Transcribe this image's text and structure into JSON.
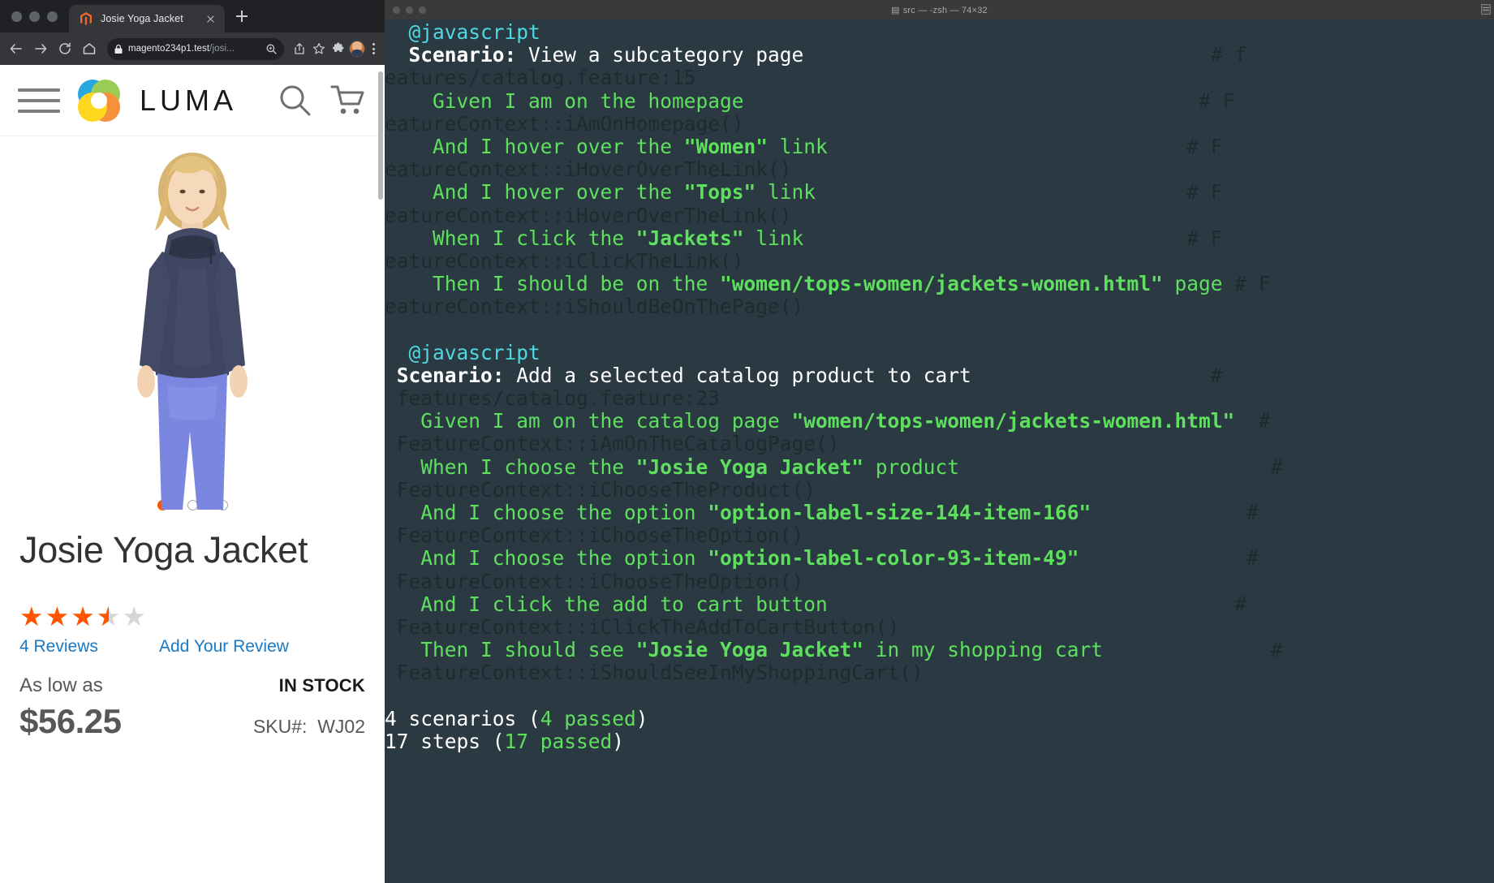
{
  "browser": {
    "tab": {
      "title": "Josie Yoga Jacket",
      "favicon": "magento-icon",
      "close_label": "×"
    },
    "new_tab_label": "+",
    "toolbar": {
      "back_icon": "back-arrow-icon",
      "forward_icon": "forward-arrow-icon",
      "reload_icon": "reload-icon",
      "home_icon": "home-icon",
      "lock_icon": "lock-icon",
      "url_host": "magento234p1.test",
      "url_path": "/josi...",
      "zoom_icon": "zoom-search-icon",
      "share_icon": "share-icon",
      "bookmark_icon": "star-icon",
      "extensions_icon": "puzzle-icon",
      "profile_icon": "avatar",
      "menu_icon": "kebab-menu-icon"
    }
  },
  "store": {
    "brand": "LUMA",
    "logo_name": "luma-logo",
    "menu_icon": "hamburger-icon",
    "search_icon": "search-icon",
    "cart_icon": "cart-icon",
    "gallery": {
      "dots": [
        {
          "active": true
        },
        {
          "active": false
        },
        {
          "active": false
        }
      ]
    },
    "product": {
      "title": "Josie Yoga Jacket",
      "rating_stars": 3.5,
      "stars": [
        "full",
        "full",
        "full",
        "half",
        "empty"
      ],
      "reviews_link": "4  Reviews",
      "add_review_link": "Add Your Review",
      "as_low_as_label": "As low as",
      "price": "$56.25",
      "stock_status": "IN STOCK",
      "sku_label": "SKU#:",
      "sku_value": "WJ02"
    }
  },
  "terminal": {
    "title": "src — -zsh — 74×32",
    "title_icon": "terminal-icon",
    "lines": [
      {
        "id": "l01",
        "segments": [
          {
            "t": "  ",
            "c": "c-step"
          },
          {
            "t": "@javascript",
            "c": "c-tag"
          }
        ]
      },
      {
        "id": "l02",
        "segments": [
          {
            "t": "  ",
            "c": "c-white"
          },
          {
            "t": "Scenario:",
            "c": "c-wbold"
          },
          {
            "t": " View a subcategory page",
            "c": "c-white"
          },
          {
            "t": "                                  # f",
            "c": "c-dim"
          }
        ]
      },
      {
        "id": "l03",
        "segments": [
          {
            "t": "eatures/catalog.feature:15",
            "c": "c-dim"
          }
        ]
      },
      {
        "id": "l04",
        "segments": [
          {
            "t": "    Given I am on the homepage",
            "c": "c-step"
          },
          {
            "t": "                                      # F",
            "c": "c-dim"
          }
        ]
      },
      {
        "id": "l05",
        "segments": [
          {
            "t": "eatureContext::iAmOnHomepage()",
            "c": "c-dim"
          }
        ]
      },
      {
        "id": "l06",
        "segments": [
          {
            "t": "    And I hover over the ",
            "c": "c-step"
          },
          {
            "t": "\"Women\"",
            "c": "c-bold"
          },
          {
            "t": " link",
            "c": "c-step"
          },
          {
            "t": "                              # F",
            "c": "c-dim"
          }
        ]
      },
      {
        "id": "l07",
        "segments": [
          {
            "t": "eatureContext::iHoverOverTheLink()",
            "c": "c-dim"
          }
        ]
      },
      {
        "id": "l08",
        "segments": [
          {
            "t": "    And I hover over the ",
            "c": "c-step"
          },
          {
            "t": "\"Tops\"",
            "c": "c-bold"
          },
          {
            "t": " link",
            "c": "c-step"
          },
          {
            "t": "                               # F",
            "c": "c-dim"
          }
        ]
      },
      {
        "id": "l09",
        "segments": [
          {
            "t": "eatureContext::iHoverOverTheLink()",
            "c": "c-dim"
          }
        ]
      },
      {
        "id": "l10",
        "segments": [
          {
            "t": "    When I click the ",
            "c": "c-step"
          },
          {
            "t": "\"Jackets\"",
            "c": "c-bold"
          },
          {
            "t": " link",
            "c": "c-step"
          },
          {
            "t": "                                # F",
            "c": "c-dim"
          }
        ]
      },
      {
        "id": "l11",
        "segments": [
          {
            "t": "eatureContext::iClickTheLink()",
            "c": "c-dim"
          }
        ]
      },
      {
        "id": "l12",
        "segments": [
          {
            "t": "    Then I should be on the ",
            "c": "c-step"
          },
          {
            "t": "\"women/tops-women/jackets-women.html\"",
            "c": "c-bold"
          },
          {
            "t": " page",
            "c": "c-step"
          },
          {
            "t": " # F",
            "c": "c-dim"
          }
        ]
      },
      {
        "id": "l13",
        "segments": [
          {
            "t": "eatureContext::iShouldBeOnThePage()",
            "c": "c-dim"
          }
        ]
      },
      {
        "id": "l14",
        "segments": [
          {
            "t": "",
            "c": "c-step"
          }
        ]
      },
      {
        "id": "l15",
        "segments": [
          {
            "t": "  ",
            "c": "c-step"
          },
          {
            "t": "@javascript",
            "c": "c-tag"
          }
        ]
      },
      {
        "id": "l16",
        "segments": [
          {
            "t": " ",
            "c": "c-white"
          },
          {
            "t": "Scenario:",
            "c": "c-wbold"
          },
          {
            "t": " Add a selected catalog product to cart",
            "c": "c-white"
          },
          {
            "t": "                    #",
            "c": "c-dim"
          }
        ]
      },
      {
        "id": "l17",
        "segments": [
          {
            "t": " features/catalog.feature:23",
            "c": "c-dim"
          }
        ]
      },
      {
        "id": "l18",
        "segments": [
          {
            "t": "   Given I am on the catalog page ",
            "c": "c-step"
          },
          {
            "t": "\"women/tops-women/jackets-women.html\"",
            "c": "c-bold"
          },
          {
            "t": "  #",
            "c": "c-dim"
          }
        ]
      },
      {
        "id": "l19",
        "segments": [
          {
            "t": " FeatureContext::iAmOnTheCatalogPage()",
            "c": "c-dim"
          }
        ]
      },
      {
        "id": "l20",
        "segments": [
          {
            "t": "   When I choose the ",
            "c": "c-step"
          },
          {
            "t": "\"Josie Yoga Jacket\"",
            "c": "c-bold"
          },
          {
            "t": " product",
            "c": "c-step"
          },
          {
            "t": "                          #",
            "c": "c-dim"
          }
        ]
      },
      {
        "id": "l21",
        "segments": [
          {
            "t": " FeatureContext::iChooseTheProduct()",
            "c": "c-dim"
          }
        ]
      },
      {
        "id": "l22",
        "segments": [
          {
            "t": "   And I choose the option ",
            "c": "c-step"
          },
          {
            "t": "\"option-label-size-144-item-166\"",
            "c": "c-bold"
          },
          {
            "t": "             #",
            "c": "c-dim"
          }
        ]
      },
      {
        "id": "l23",
        "segments": [
          {
            "t": " FeatureContext::iChooseTheOption()",
            "c": "c-dim"
          }
        ]
      },
      {
        "id": "l24",
        "segments": [
          {
            "t": "   And I choose the option ",
            "c": "c-step"
          },
          {
            "t": "\"option-label-color-93-item-49\"",
            "c": "c-bold"
          },
          {
            "t": "              #",
            "c": "c-dim"
          }
        ]
      },
      {
        "id": "l25",
        "segments": [
          {
            "t": " FeatureContext::iChooseTheOption()",
            "c": "c-dim"
          }
        ]
      },
      {
        "id": "l26",
        "segments": [
          {
            "t": "   And I click the add to cart button",
            "c": "c-step"
          },
          {
            "t": "                                  #",
            "c": "c-dim"
          }
        ]
      },
      {
        "id": "l27",
        "segments": [
          {
            "t": " FeatureContext::iClickTheAddToCartButton()",
            "c": "c-dim"
          }
        ]
      },
      {
        "id": "l28",
        "segments": [
          {
            "t": "   Then I should see ",
            "c": "c-step"
          },
          {
            "t": "\"Josie Yoga Jacket\"",
            "c": "c-bold"
          },
          {
            "t": " in my shopping cart",
            "c": "c-step"
          },
          {
            "t": "              #",
            "c": "c-dim"
          }
        ]
      },
      {
        "id": "l29",
        "segments": [
          {
            "t": " FeatureContext::iShouldSeeInMyShoppingCart()",
            "c": "c-dim"
          }
        ]
      },
      {
        "id": "l30",
        "segments": [
          {
            "t": "",
            "c": "c-step"
          }
        ]
      },
      {
        "id": "l31",
        "segments": [
          {
            "t": "4 scenarios (",
            "c": "c-white"
          },
          {
            "t": "4 passed",
            "c": "c-step"
          },
          {
            "t": ")",
            "c": "c-white"
          }
        ]
      },
      {
        "id": "l32",
        "segments": [
          {
            "t": "17 steps (",
            "c": "c-white"
          },
          {
            "t": "17 passed",
            "c": "c-step"
          },
          {
            "t": ")",
            "c": "c-white"
          }
        ]
      }
    ]
  },
  "colors": {
    "terminal_bg": "#2b3a42",
    "terminal_green": "#5ee05e",
    "terminal_cyan": "#4fd8e0",
    "terminal_comment": "#1f2a30",
    "accent_orange": "#ff5501",
    "link_blue": "#1979c3",
    "browser_chrome": "#35363a"
  }
}
